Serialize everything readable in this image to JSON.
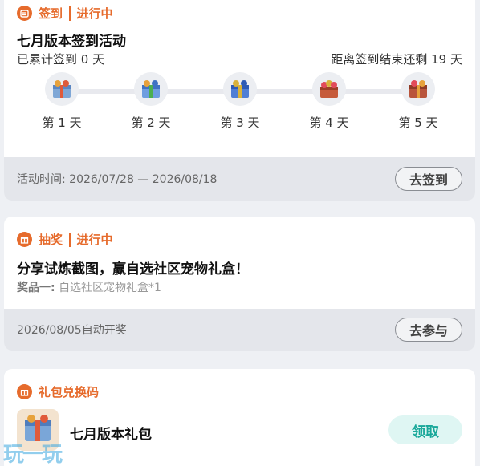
{
  "signin": {
    "tag": "签到",
    "status": "进行中",
    "title": "七月版本签到活动",
    "accumulated": "已累计签到 0 天",
    "remaining": "距离签到结束还剩 19 天",
    "days": [
      {
        "label": "第 1 天",
        "icon": "gift-box-icon"
      },
      {
        "label": "第 2 天",
        "icon": "gift-box-icon"
      },
      {
        "label": "第 3 天",
        "icon": "gift-box-icon"
      },
      {
        "label": "第 4 天",
        "icon": "gift-box-icon"
      },
      {
        "label": "第 5 天",
        "icon": "gift-box-icon"
      }
    ],
    "period": "活动时间: 2026/07/28 — 2026/08/18",
    "button": "去签到"
  },
  "lottery": {
    "tag": "抽奖",
    "status": "进行中",
    "title": "分享试炼截图，赢自选社区宠物礼盒！",
    "prize_label": "奖品一:",
    "prize_value": "自选社区宠物礼盒*1",
    "draw_time": "2026/08/05自动开奖",
    "button": "去参与"
  },
  "giftcode": {
    "tag": "礼包兑换码",
    "name": "七月版本礼包",
    "button": "领取"
  },
  "watermark": "玩一玩",
  "colors": {
    "accent": "#e66b2c",
    "teal": "#19a89a",
    "footer_bg": "#e4e6eb"
  }
}
